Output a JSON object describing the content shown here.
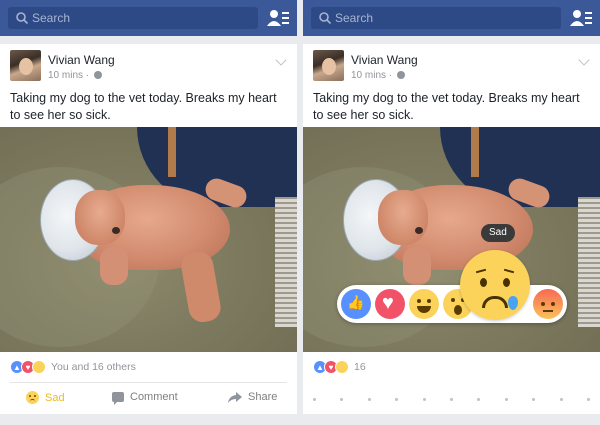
{
  "search": {
    "placeholder": "Search"
  },
  "post": {
    "author": "Vivian Wang",
    "time": "10 mins",
    "separator": "·",
    "text": "Taking my dog to the vet today. Breaks my heart to see her so sick."
  },
  "left": {
    "reactions_summary": "You and 16 others",
    "actions": {
      "reaction": "Sad",
      "comment": "Comment",
      "share": "Share"
    }
  },
  "right": {
    "reactions_summary": "16",
    "tooltip": "Sad"
  },
  "colors": {
    "brand": "#3b5998",
    "like": "#5890ff",
    "love": "#f25268",
    "sad": "#fbd35b",
    "sad_text": "#f0ba15"
  },
  "icons": [
    "search-icon",
    "friends-icon",
    "globe-icon",
    "chevron-down-icon",
    "sad-icon",
    "comment-icon",
    "share-icon"
  ]
}
